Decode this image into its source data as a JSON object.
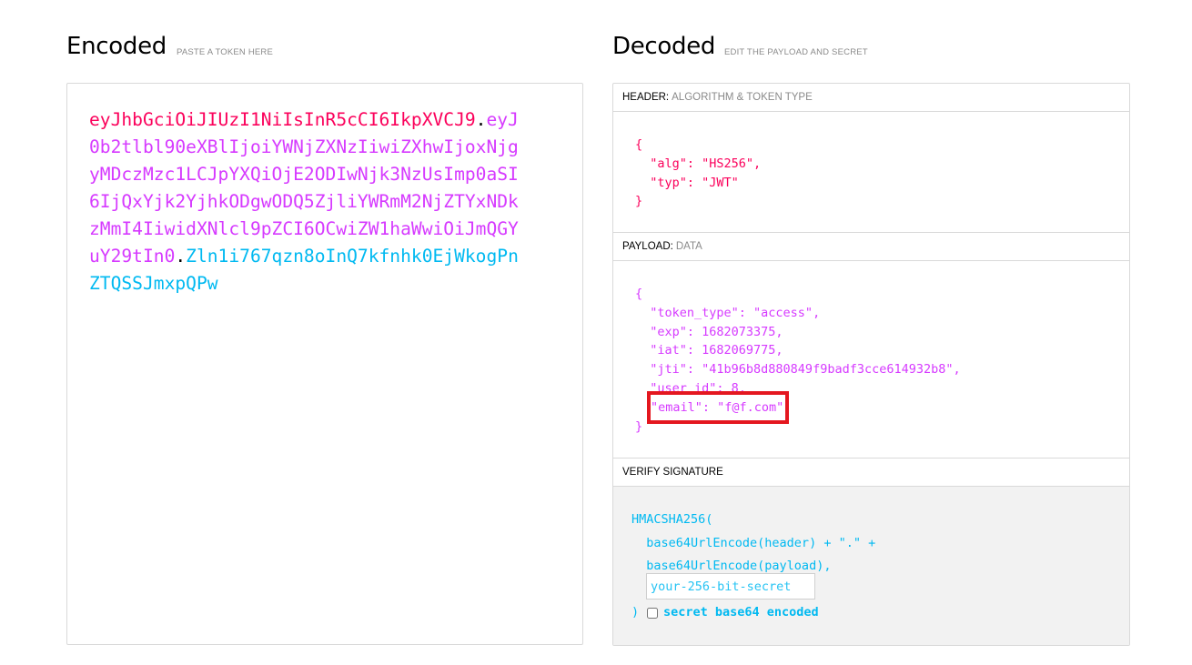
{
  "encoded": {
    "title": "Encoded",
    "subtitle": "PASTE A TOKEN HERE",
    "token": {
      "header": "eyJhbGciOiJIUzI1NiIsInR5cCI6IkpXVCJ9",
      "dot1": ".",
      "payload": "eyJ0b2tlbl90eXBlIjoiYWNjZXNzIiwiZXhwIjoxNjgyMDczMzc1LCJpYXQiOjE2ODIwNjk3NzUsImp0aSI6IjQxYjk2YjhkODgwODQ5ZjliYWRmM2NjZTYxNDkzMmI4IiwidXNlcl9pZCI6OCwiZW1haWwiOiJmQGYuY29tIn0",
      "dot2": ".",
      "signature": "Zln1i767qzn8oInQ7kfnhk0EjWkogPnZTQSSJmxpQPw"
    }
  },
  "decoded": {
    "title": "Decoded",
    "subtitle": "EDIT THE PAYLOAD AND SECRET",
    "header_section": {
      "label": "HEADER:",
      "sublabel": "ALGORITHM & TOKEN TYPE",
      "json": "{\n  \"alg\": \"HS256\",\n  \"typ\": \"JWT\"\n}"
    },
    "payload_section": {
      "label": "PAYLOAD:",
      "sublabel": "DATA",
      "json": "{\n  \"token_type\": \"access\",\n  \"exp\": 1682073375,\n  \"iat\": 1682069775,\n  \"jti\": \"41b96b8d880849f9badf3cce614932b8\",\n  \"user_id\": 8,\n\n}",
      "highlighted_line": "\"email\": \"f@f.com\""
    },
    "verify_section": {
      "label": "VERIFY SIGNATURE",
      "code": "HMACSHA256(\n  base64UrlEncode(header) + \".\" +\n  base64UrlEncode(payload),",
      "secret_placeholder": "your-256-bit-secret",
      "close_paren": ")",
      "base64_label": "secret base64 encoded"
    }
  },
  "colors": {
    "header": "#fb015b",
    "payload": "#d63aff",
    "signature": "#00b9f1",
    "highlight_border": "#e4171f"
  }
}
